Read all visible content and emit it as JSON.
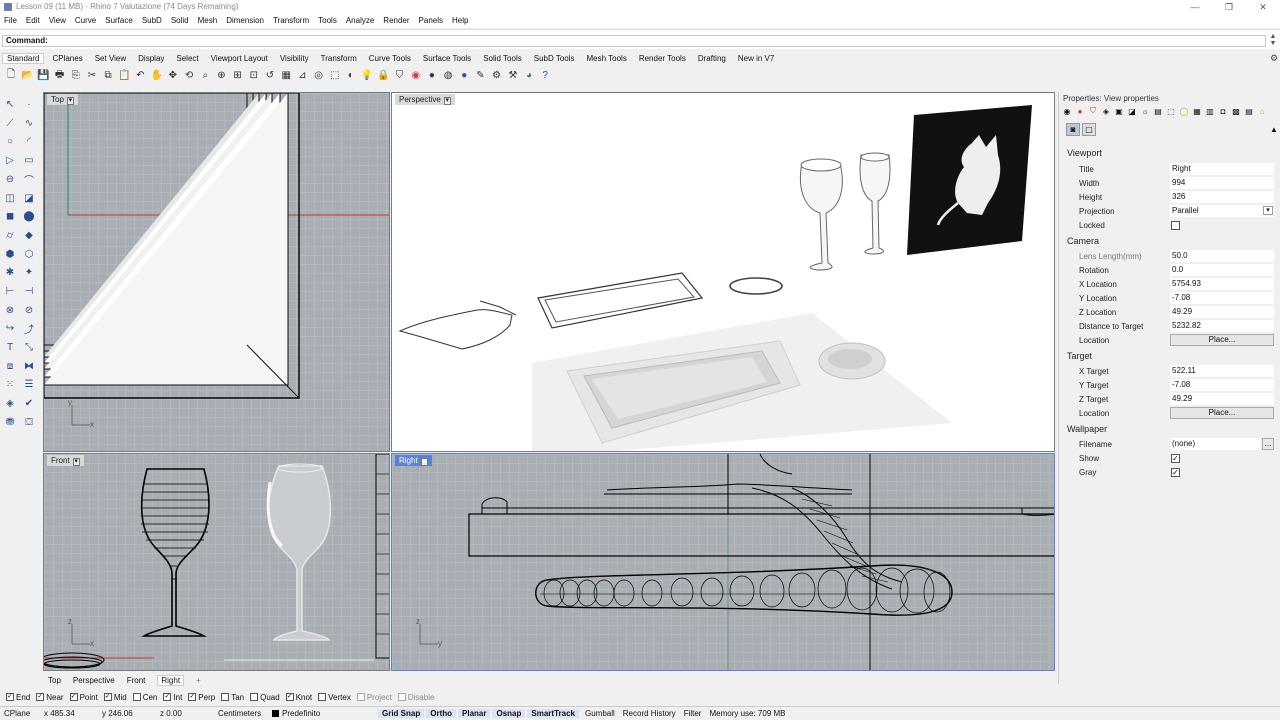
{
  "window": {
    "title": "Lesson 09 (11 MB) - Rhino 7 Valutazione (74 Days Remaining)",
    "minimize": "—",
    "restore": "❐",
    "close": "✕"
  },
  "menu": [
    "File",
    "Edit",
    "View",
    "Curve",
    "Surface",
    "SubD",
    "Solid",
    "Mesh",
    "Dimension",
    "Transform",
    "Tools",
    "Analyze",
    "Render",
    "Panels",
    "Help"
  ],
  "command": {
    "label": "Command:"
  },
  "toolbar_tabs": [
    "Standard",
    "CPlanes",
    "Set View",
    "Display",
    "Select",
    "Viewport Layout",
    "Visibility",
    "Transform",
    "Curve Tools",
    "Surface Tools",
    "Solid Tools",
    "SubD Tools",
    "Mesh Tools",
    "Render Tools",
    "Drafting",
    "New in V7"
  ],
  "viewports": {
    "top": {
      "label": "Top"
    },
    "perspective": {
      "label": "Perspective"
    },
    "front": {
      "label": "Front"
    },
    "right": {
      "label": "Right"
    }
  },
  "axis": {
    "x": "x",
    "y": "y",
    "z": "z"
  },
  "viewport_tabs": [
    "Top",
    "Perspective",
    "Front",
    "Right"
  ],
  "viewport_tab_add": "+",
  "osnaps": [
    {
      "label": "End",
      "checked": true
    },
    {
      "label": "Near",
      "checked": true
    },
    {
      "label": "Point",
      "checked": true
    },
    {
      "label": "Mid",
      "checked": true
    },
    {
      "label": "Cen",
      "checked": false
    },
    {
      "label": "Int",
      "checked": true
    },
    {
      "label": "Perp",
      "checked": true
    },
    {
      "label": "Tan",
      "checked": false
    },
    {
      "label": "Quad",
      "checked": false
    },
    {
      "label": "Knot",
      "checked": true
    },
    {
      "label": "Vertex",
      "checked": false
    },
    {
      "label": "Project",
      "checked": false,
      "dim": true
    },
    {
      "label": "Disable",
      "checked": false,
      "dim": true
    }
  ],
  "status": {
    "cplane": "CPlane",
    "x": "x 485.34",
    "y": "y 246.06",
    "z": "z 0.00",
    "units": "Centimeters",
    "layer": "Predefinito",
    "grid_snap": "Grid Snap",
    "ortho": "Ortho",
    "planar": "Planar",
    "osnap": "Osnap",
    "smarttrack": "SmartTrack",
    "gumball": "Gumball",
    "record_history": "Record History",
    "filter": "Filter",
    "memory": "Memory use: 709 MB"
  },
  "properties": {
    "title": "Properties: View properties",
    "viewport_section": "Viewport",
    "title_label": "Title",
    "title_value": "Right",
    "width_label": "Width",
    "width_value": "994",
    "height_label": "Height",
    "height_value": "326",
    "projection_label": "Projection",
    "projection_value": "Parallel",
    "locked_label": "Locked",
    "camera_section": "Camera",
    "lens_label": "Lens Length(mm)",
    "lens_value": "50.0",
    "rotation_label": "Rotation",
    "rotation_value": "0.0",
    "xloc_label": "X Location",
    "xloc_value": "5754.93",
    "yloc_label": "Y Location",
    "yloc_value": "-7.08",
    "zloc_label": "Z Location",
    "zloc_value": "49.29",
    "dist_label": "Distance to Target",
    "dist_value": "5232.82",
    "location_label": "Location",
    "place_label": "Place...",
    "target_section": "Target",
    "xt_label": "X Target",
    "xt_value": "522.11",
    "yt_label": "Y Target",
    "yt_value": "-7.08",
    "zt_label": "Z Target",
    "zt_value": "49.29",
    "tlocation_label": "Location",
    "tplace_label": "Place...",
    "wallpaper_section": "Wallpaper",
    "filename_label": "Filename",
    "filename_value": "(none)",
    "browse_label": "...",
    "show_label": "Show",
    "gray_label": "Gray"
  },
  "colors": {
    "accent": "#5a83d8",
    "grid": "#a8aeb4",
    "x_axis": "#c0392b",
    "y_axis": "#2e8b57"
  }
}
